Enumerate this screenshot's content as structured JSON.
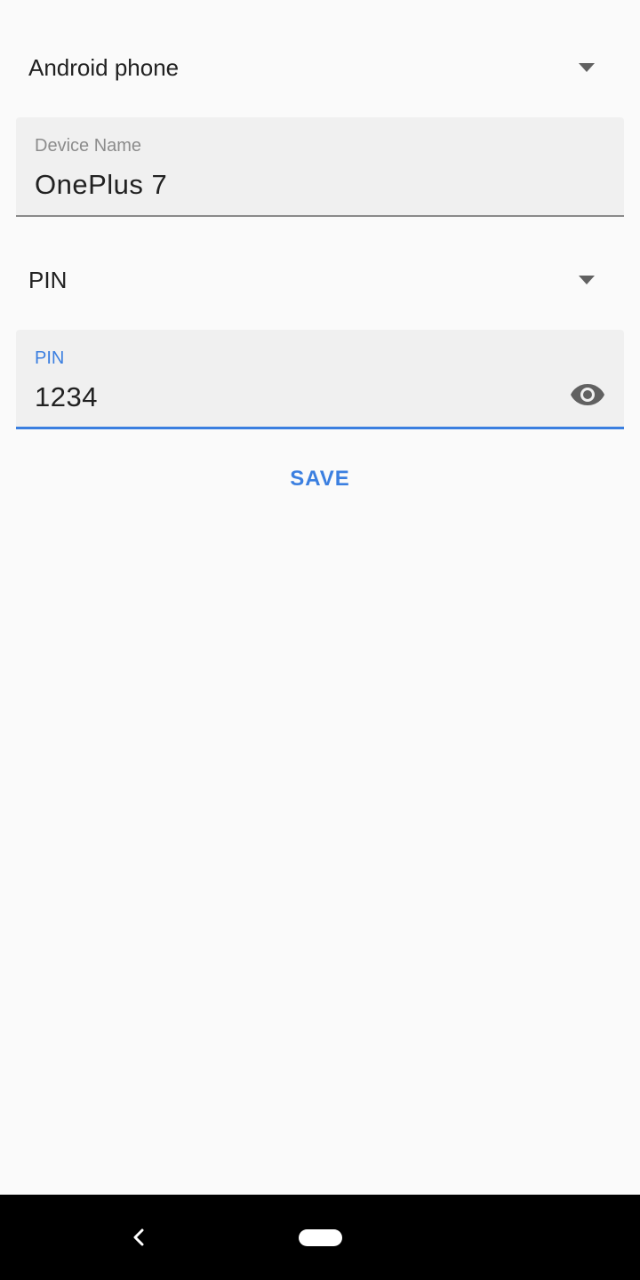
{
  "device_type_spinner": {
    "selected": "Android phone",
    "icon": "dropdown-arrow-icon"
  },
  "device_name_field": {
    "label": "Device Name",
    "value": "OnePlus 7"
  },
  "auth_type_spinner": {
    "selected": "PIN",
    "icon": "dropdown-arrow-icon"
  },
  "pin_field": {
    "label": "PIN",
    "value": "1234",
    "icon": "visibility-eye-icon"
  },
  "save_button": {
    "label": "SAVE"
  },
  "navigation_bar": {
    "back_icon": "back-chevron-icon",
    "home_icon": "home-pill-icon"
  },
  "colors": {
    "accent": "#3b7fe0",
    "background": "#fafafa",
    "field_background": "#f0f0f0",
    "nav_background": "#000000"
  }
}
